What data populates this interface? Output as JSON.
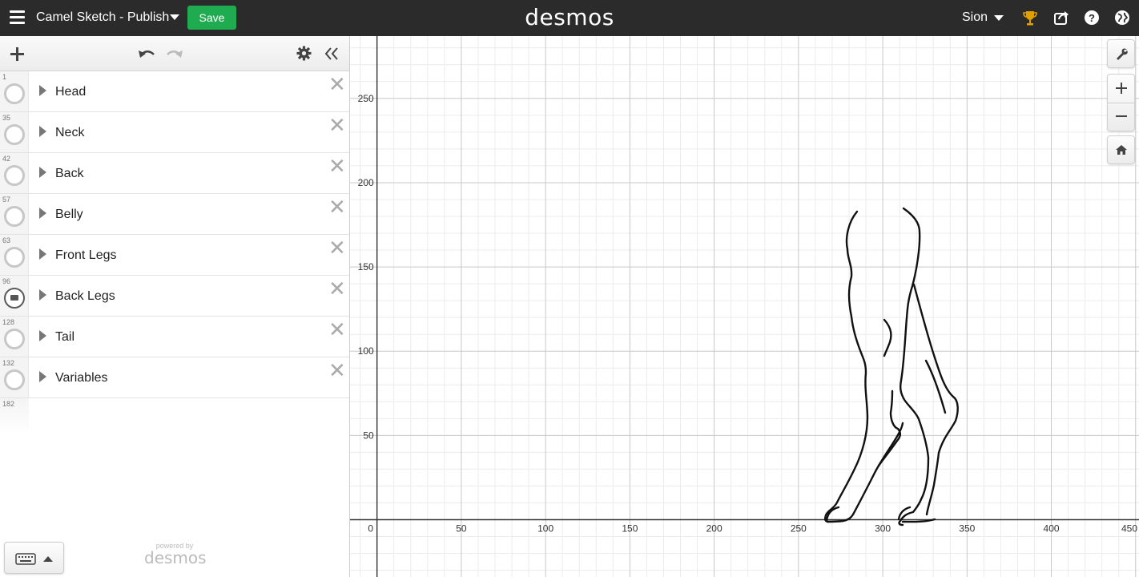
{
  "header": {
    "graph_title": "Camel Sketch - Publish",
    "save_label": "Save",
    "logo": "desmos",
    "user_name": "Sion"
  },
  "expressions": [
    {
      "index": "1",
      "label": "Head",
      "icon": "circle-toggle"
    },
    {
      "index": "35",
      "label": "Neck",
      "icon": "circle-toggle"
    },
    {
      "index": "42",
      "label": "Back",
      "icon": "circle-toggle"
    },
    {
      "index": "57",
      "label": "Belly",
      "icon": "circle-toggle"
    },
    {
      "index": "63",
      "label": "Front Legs",
      "icon": "circle-toggle"
    },
    {
      "index": "96",
      "label": "Back Legs",
      "icon": "folder-icon"
    },
    {
      "index": "128",
      "label": "Tail",
      "icon": "circle-toggle"
    },
    {
      "index": "132",
      "label": "Variables",
      "icon": "circle-toggle"
    }
  ],
  "empty_index": "182",
  "footer": {
    "powered_by": "powered by",
    "brand": "desmos"
  },
  "graph": {
    "x_ticks": [
      "0",
      "50",
      "100",
      "150",
      "200",
      "250",
      "300",
      "350",
      "400",
      "450"
    ],
    "y_ticks": [
      "50",
      "100",
      "150",
      "200",
      "250"
    ],
    "x_range": [
      -16,
      452
    ],
    "y_range": [
      -34,
      287
    ],
    "grid": true
  },
  "colors": {
    "topbar": "#2b2b2b",
    "save": "#1fab4f",
    "trophy": "#e0a000"
  }
}
